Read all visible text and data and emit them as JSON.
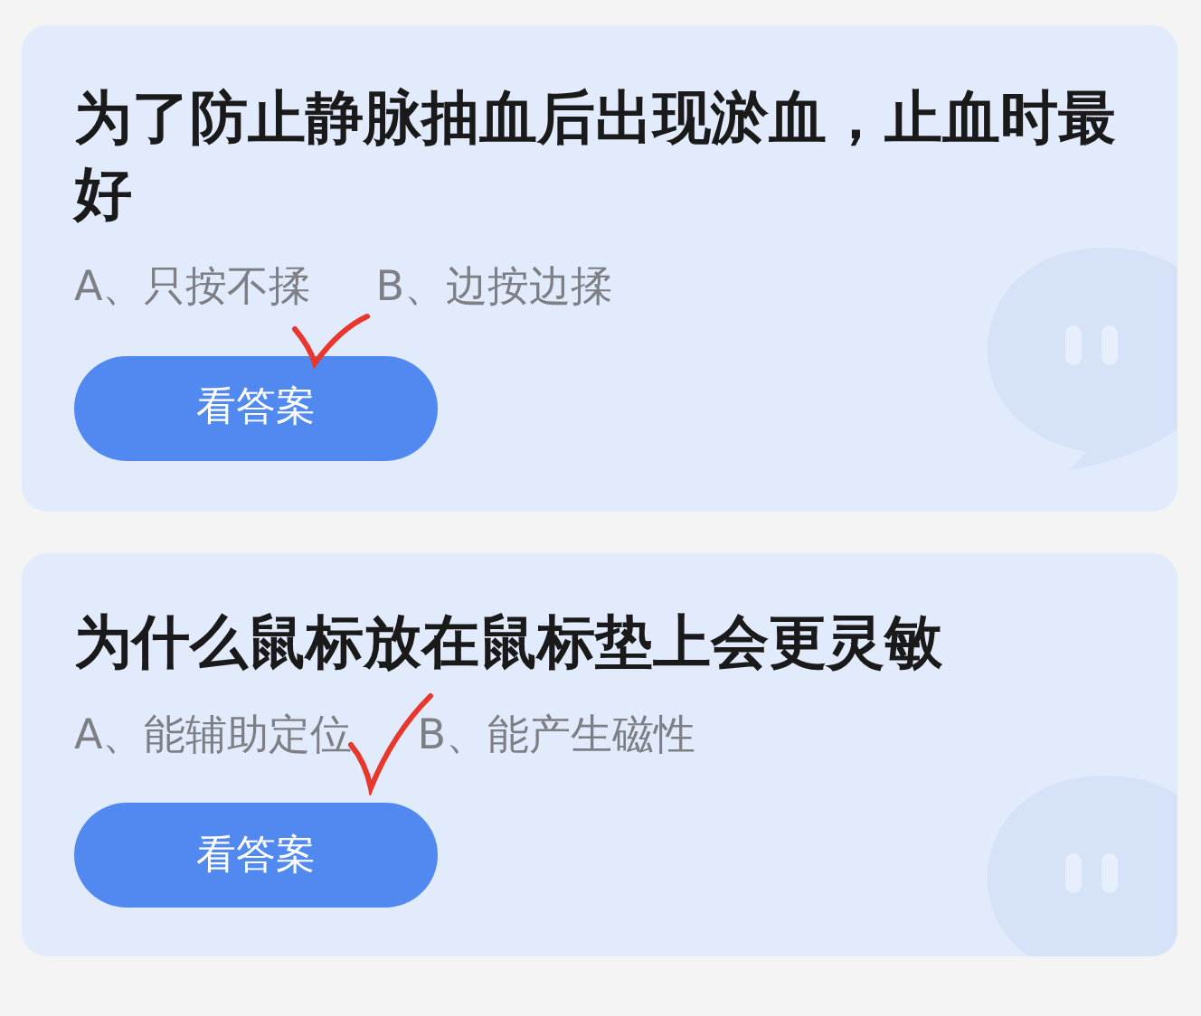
{
  "questions": [
    {
      "title": "为了防止静脉抽血后出现淤血，止血时最好",
      "options": [
        {
          "text": "A、只按不揉",
          "marked": true
        },
        {
          "text": "B、边按边揉",
          "marked": false
        }
      ],
      "button": "看答案"
    },
    {
      "title": "为什么鼠标放在鼠标垫上会更灵敏",
      "options": [
        {
          "text": "A、能辅助定位",
          "marked": true
        },
        {
          "text": "B、能产生磁性",
          "marked": false
        }
      ],
      "button": "看答案"
    }
  ]
}
